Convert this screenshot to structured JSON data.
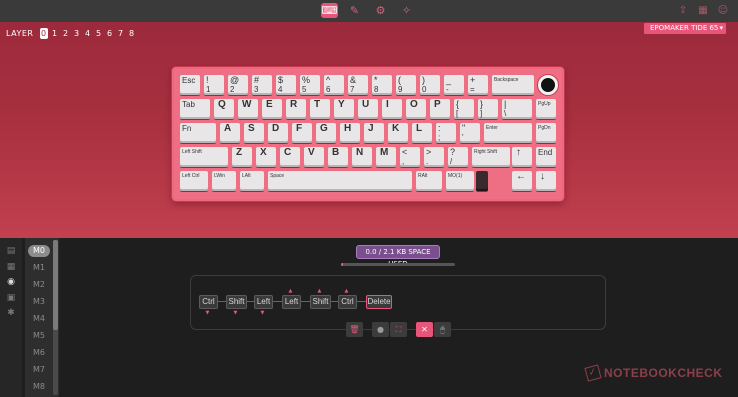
{
  "topbar": {
    "tabs": [
      {
        "icon": "keyboard-icon",
        "glyph": "⌨",
        "active": true
      },
      {
        "icon": "lighting-icon",
        "glyph": "✎",
        "active": false
      },
      {
        "icon": "macro-icon",
        "glyph": "⚙",
        "active": false
      },
      {
        "icon": "settings-icon",
        "glyph": "✧",
        "active": false
      }
    ],
    "right_icons": [
      {
        "icon": "share-icon",
        "glyph": "⇪"
      },
      {
        "icon": "grid-icon",
        "glyph": "▦"
      },
      {
        "icon": "user-icon",
        "glyph": "☺"
      }
    ]
  },
  "layers": {
    "label": "LAYER",
    "items": [
      "0",
      "1",
      "2",
      "3",
      "4",
      "5",
      "6",
      "7",
      "8"
    ],
    "selected": "0"
  },
  "device": {
    "name": "EPOMAKER TIDE 65",
    "chevron": "▾"
  },
  "keyboard": {
    "keys": [
      {
        "label": "Esc"
      },
      {
        "top": "!",
        "label": "1"
      },
      {
        "top": "@",
        "label": "2"
      },
      {
        "top": "#",
        "label": "3"
      },
      {
        "top": "$",
        "label": "4"
      },
      {
        "top": "%",
        "label": "5"
      },
      {
        "top": "^",
        "label": "6"
      },
      {
        "top": "&",
        "label": "7"
      },
      {
        "top": "*",
        "label": "8"
      },
      {
        "top": "(",
        "label": "9"
      },
      {
        "top": ")",
        "label": "0"
      },
      {
        "top": "_",
        "label": "-"
      },
      {
        "top": "+",
        "label": "="
      },
      {
        "label": "Backspace"
      },
      {
        "label": "Tab"
      },
      {
        "label": "Q"
      },
      {
        "label": "W"
      },
      {
        "label": "E"
      },
      {
        "label": "R"
      },
      {
        "label": "T"
      },
      {
        "label": "Y"
      },
      {
        "label": "U"
      },
      {
        "label": "I"
      },
      {
        "label": "O"
      },
      {
        "label": "P"
      },
      {
        "top": "{",
        "label": "["
      },
      {
        "top": "}",
        "label": "]"
      },
      {
        "top": "|",
        "label": "\\"
      },
      {
        "label": "PgUp"
      },
      {
        "label": "Fn"
      },
      {
        "label": "A"
      },
      {
        "label": "S"
      },
      {
        "label": "D"
      },
      {
        "label": "F"
      },
      {
        "label": "G"
      },
      {
        "label": "H"
      },
      {
        "label": "J"
      },
      {
        "label": "K"
      },
      {
        "label": "L"
      },
      {
        "top": ":",
        "label": ";"
      },
      {
        "top": "\"",
        "label": "'"
      },
      {
        "label": "Enter"
      },
      {
        "label": "PgDn"
      },
      {
        "label": "Left Shift"
      },
      {
        "label": "Z"
      },
      {
        "label": "X"
      },
      {
        "label": "C"
      },
      {
        "label": "V"
      },
      {
        "label": "B"
      },
      {
        "label": "N"
      },
      {
        "label": "M"
      },
      {
        "top": "<",
        "label": ","
      },
      {
        "top": ">",
        "label": "."
      },
      {
        "top": "?",
        "label": "/"
      },
      {
        "label": "Right Shift"
      },
      {
        "label": "↑"
      },
      {
        "label": "End"
      },
      {
        "label": "Left Ctrl"
      },
      {
        "label": "LWin"
      },
      {
        "label": "LAlt"
      },
      {
        "label": "Space"
      },
      {
        "label": "RAlt"
      },
      {
        "label": "MO(1)"
      },
      {
        "label": ""
      },
      {
        "label": "←"
      },
      {
        "label": "↓"
      },
      {
        "label": "→"
      }
    ]
  },
  "left_icons": [
    {
      "icon": "layers-icon",
      "glyph": "▤"
    },
    {
      "icon": "apps-icon",
      "glyph": "▦"
    },
    {
      "icon": "macro-record-icon",
      "glyph": "◉"
    },
    {
      "icon": "save-icon",
      "glyph": "▣"
    },
    {
      "icon": "bulb-icon",
      "glyph": "✱"
    }
  ],
  "macros": {
    "items": [
      "M0",
      "M1",
      "M2",
      "M3",
      "M4",
      "M5",
      "M6",
      "M7",
      "M8"
    ],
    "selected": "M0"
  },
  "space": {
    "label": "0.0 / 2.1 KB SPACE USED",
    "used_fraction": 0.0
  },
  "macro_sequence": [
    {
      "key": "Ctrl",
      "action": "down"
    },
    {
      "key": "Shift",
      "action": "down"
    },
    {
      "key": "Left",
      "action": "down"
    },
    {
      "key": "Left",
      "action": "up"
    },
    {
      "key": "Shift",
      "action": "up"
    },
    {
      "key": "Ctrl",
      "action": "up"
    },
    {
      "key": "Delete",
      "action": "tap"
    }
  ],
  "tools": [
    {
      "icon": "delete-icon",
      "glyph": "🗑"
    },
    {
      "icon": "record-icon",
      "glyph": "●"
    },
    {
      "icon": "expand-icon",
      "glyph": "⛶"
    },
    {
      "icon": "no-delay-icon",
      "glyph": "✕"
    },
    {
      "icon": "mouse-icon",
      "glyph": "🖱"
    }
  ],
  "watermark": {
    "text": "NOTEBOOKCHECK",
    "mark": "✓"
  },
  "colors": {
    "accent": "#e8557a",
    "hero_top": "#9c2a3c",
    "hero_bottom": "#c2404f",
    "keycap": "#e9e6e8",
    "badge": "#7a4f8e"
  }
}
